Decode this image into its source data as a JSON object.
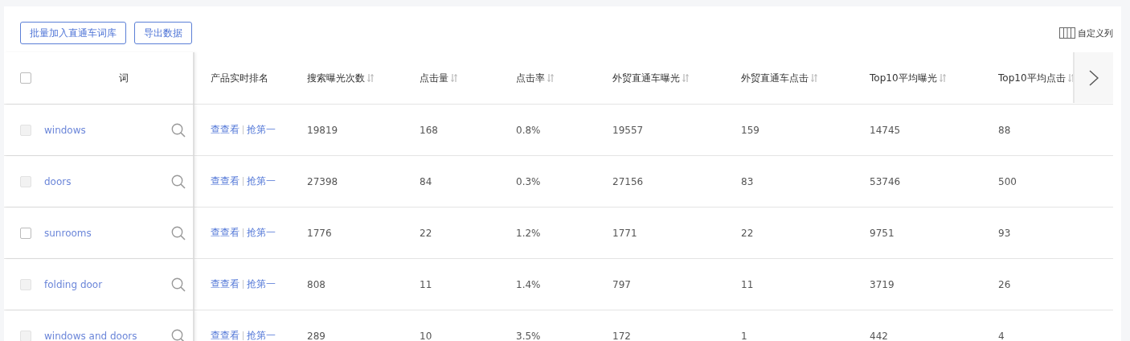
{
  "toolbar": {
    "buttons": [
      "批量加入直通车词库",
      "导出数据"
    ],
    "customize": "自定义列"
  },
  "table": {
    "header_checkbox": {
      "checked": false
    },
    "columns": [
      {
        "label": "词",
        "sortable": false
      },
      {
        "label": "产品实时排名",
        "sortable": false
      },
      {
        "label": "搜索曝光次数",
        "sortable": true
      },
      {
        "label": "点击量",
        "sortable": true
      },
      {
        "label": "点击率",
        "sortable": true
      },
      {
        "label": "外贸直通车曝光",
        "sortable": true
      },
      {
        "label": "外贸直通车点击",
        "sortable": true
      },
      {
        "label": "Top10平均曝光",
        "sortable": true
      },
      {
        "label": "Top10平均点击",
        "sortable": true
      }
    ],
    "rows": [
      {
        "word": "windows",
        "checked": false,
        "disabled": true,
        "links": [
          "查查看",
          "抢第一"
        ],
        "values": [
          "19819",
          "168",
          "0.8%",
          "19557",
          "159",
          "14745",
          "88"
        ]
      },
      {
        "word": "doors",
        "checked": false,
        "disabled": true,
        "links": [
          "查查看",
          "抢第一"
        ],
        "values": [
          "27398",
          "84",
          "0.3%",
          "27156",
          "83",
          "53746",
          "500"
        ]
      },
      {
        "word": "sunrooms",
        "checked": false,
        "disabled": false,
        "links": [
          "查查看",
          "抢第一"
        ],
        "values": [
          "1776",
          "22",
          "1.2%",
          "1771",
          "22",
          "9751",
          "93"
        ]
      },
      {
        "word": "folding door",
        "checked": false,
        "disabled": true,
        "links": [
          "查查看",
          "抢第一"
        ],
        "values": [
          "808",
          "11",
          "1.4%",
          "797",
          "11",
          "3719",
          "26"
        ]
      },
      {
        "word": "windows and doors",
        "checked": false,
        "disabled": true,
        "links": [
          "查查看",
          "抢第一"
        ],
        "values": [
          "289",
          "10",
          "3.5%",
          "172",
          "1",
          "442",
          "4"
        ]
      }
    ]
  }
}
